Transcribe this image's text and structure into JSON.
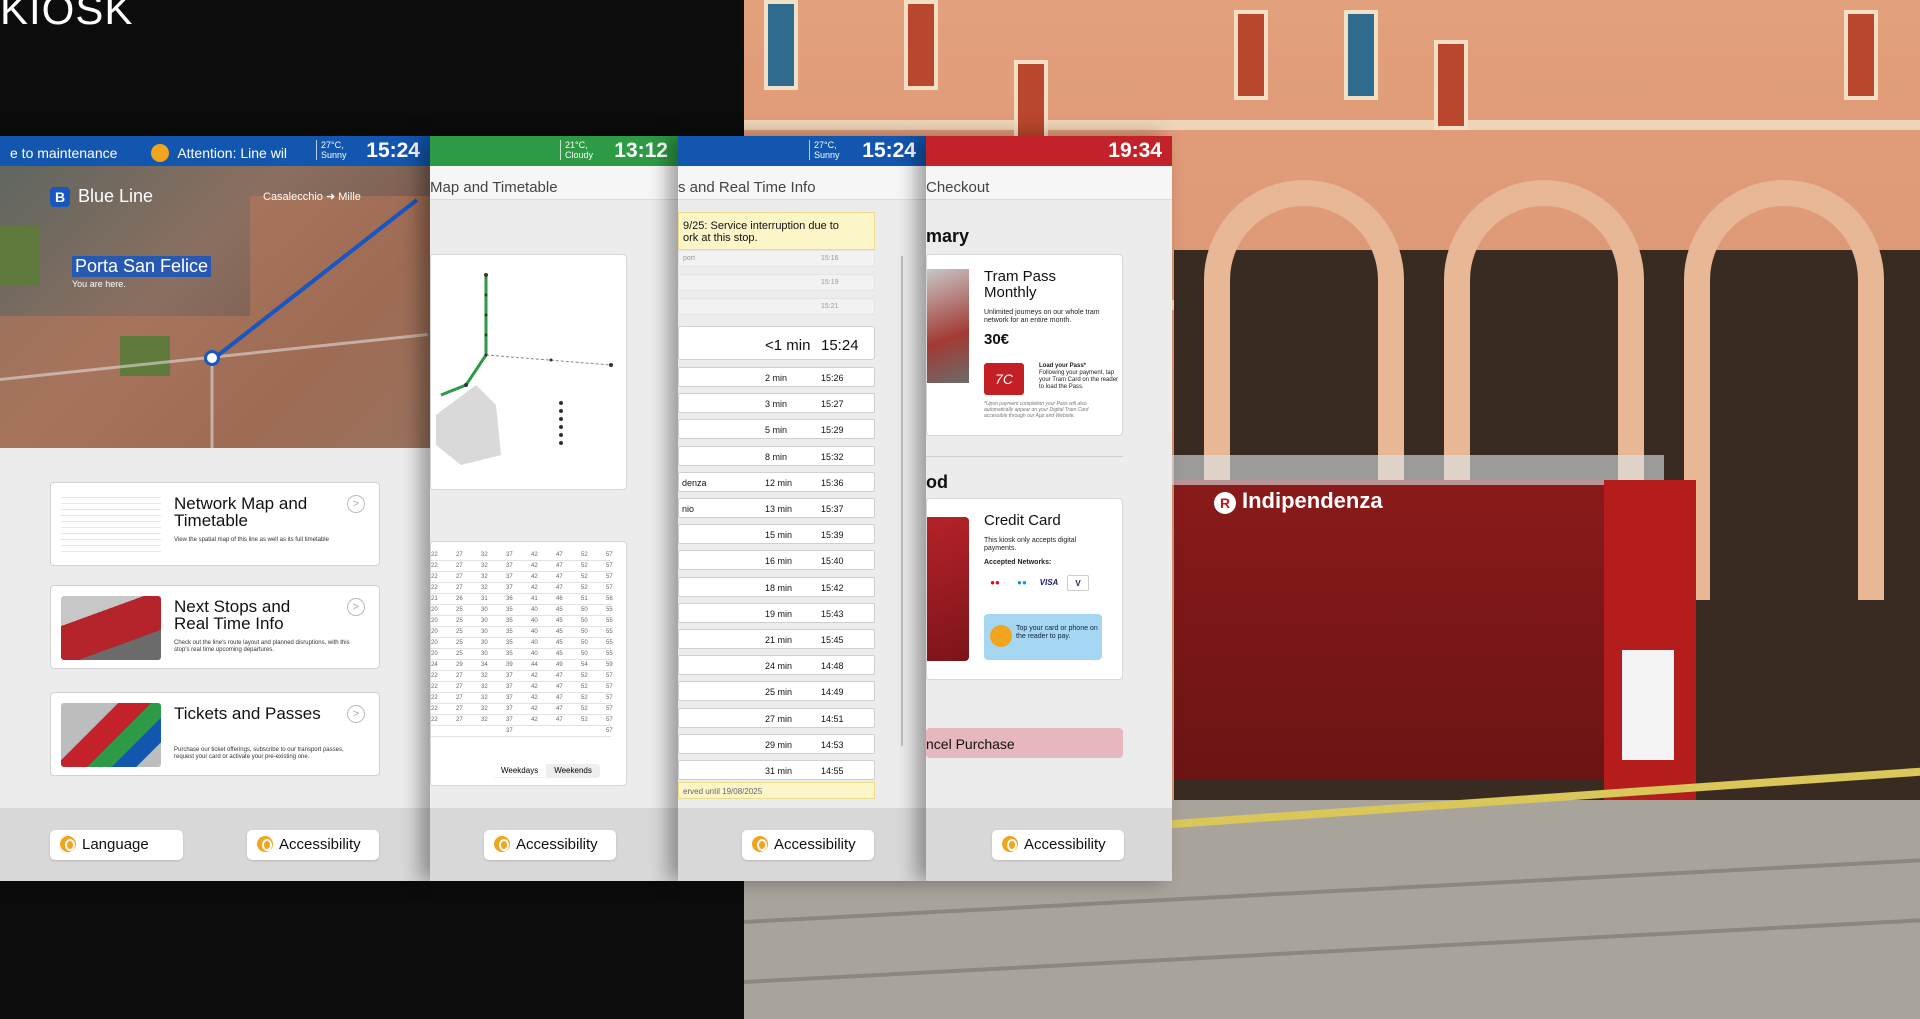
{
  "heading": "KIOSK",
  "screens": {
    "s1": {
      "marquee": "e to maintenance",
      "attention": "Attention: Line wil",
      "weather_temp": "27°C,",
      "weather_cond": "Sunny",
      "time": "15:24",
      "line_badge": "B",
      "line_name": "Blue Line",
      "route_from": "Casalecchio",
      "route_to": "Mille",
      "stop_name": "Porta San Felice",
      "here": "You are here.",
      "cards": [
        {
          "title": "Network Map and Timetable",
          "desc": "View the spatial map of this line as well as its full timetable"
        },
        {
          "title": "Next Stops and Real Time Info",
          "desc": "Check out the line's route layout and planned disruptions, with this stop's real time upcoming departures."
        },
        {
          "title": "Tickets and Passes",
          "desc": "Purchase our ticket offerings, subscribe to our transport passes, request your card or activate your pre-existing one."
        }
      ],
      "language": "Language",
      "accessibility": "Accessibility"
    },
    "s2": {
      "weather_temp": "21°C,",
      "weather_cond": "Cloudy",
      "time": "13:12",
      "title": "Map and Timetable",
      "tab_weekdays": "Weekdays",
      "tab_weekends": "Weekends",
      "accessibility": "Accessibility",
      "rows": [
        [
          "22",
          "27",
          "32",
          "37",
          "42",
          "47",
          "52",
          "57"
        ],
        [
          "22",
          "27",
          "32",
          "37",
          "42",
          "47",
          "52",
          "57"
        ],
        [
          "22",
          "27",
          "32",
          "37",
          "42",
          "47",
          "52",
          "57"
        ],
        [
          "22",
          "27",
          "32",
          "37",
          "42",
          "47",
          "52",
          "57"
        ],
        [
          "21",
          "26",
          "31",
          "36",
          "41",
          "46",
          "51",
          "56"
        ],
        [
          "20",
          "25",
          "30",
          "35",
          "40",
          "45",
          "50",
          "55"
        ],
        [
          "20",
          "25",
          "30",
          "35",
          "40",
          "45",
          "50",
          "55"
        ],
        [
          "20",
          "25",
          "30",
          "35",
          "40",
          "45",
          "50",
          "55"
        ],
        [
          "20",
          "25",
          "30",
          "35",
          "40",
          "45",
          "50",
          "55"
        ],
        [
          "20",
          "25",
          "30",
          "35",
          "40",
          "45",
          "50",
          "55"
        ],
        [
          "24",
          "29",
          "34",
          "39",
          "44",
          "49",
          "54",
          "59"
        ],
        [
          "22",
          "27",
          "32",
          "37",
          "42",
          "47",
          "52",
          "57"
        ],
        [
          "22",
          "27",
          "32",
          "37",
          "42",
          "47",
          "52",
          "57"
        ],
        [
          "22",
          "27",
          "32",
          "37",
          "42",
          "47",
          "52",
          "57"
        ],
        [
          "22",
          "27",
          "32",
          "37",
          "42",
          "47",
          "52",
          "57"
        ],
        [
          "22",
          "27",
          "32",
          "37",
          "42",
          "47",
          "52",
          "57"
        ],
        [
          "",
          "",
          "",
          "37",
          "",
          "",
          "",
          "57"
        ]
      ]
    },
    "s3": {
      "weather_temp": "27°C,",
      "weather_cond": "Sunny",
      "time": "15:24",
      "title": "s and Real Time Info",
      "alert_l1": "9/25: Service interruption due to",
      "alert_l2": "ork at this stop.",
      "past": [
        {
          "name": "port",
          "time": "15:16"
        },
        {
          "name": "",
          "time": "15:19"
        },
        {
          "name": "",
          "time": "15:21"
        }
      ],
      "next_wait": "<1 min",
      "next_time": "15:24",
      "departures": [
        {
          "name": "",
          "wait": "2 min",
          "time": "15:26"
        },
        {
          "name": "",
          "wait": "3 min",
          "time": "15:27"
        },
        {
          "name": "",
          "wait": "5 min",
          "time": "15:29"
        },
        {
          "name": "",
          "wait": "8 min",
          "time": "15:32"
        },
        {
          "name": "denza",
          "wait": "12 min",
          "time": "15:36"
        },
        {
          "name": "nio",
          "wait": "13 min",
          "time": "15:37"
        },
        {
          "name": "",
          "wait": "15 min",
          "time": "15:39"
        },
        {
          "name": "",
          "wait": "16 min",
          "time": "15:40"
        },
        {
          "name": "",
          "wait": "18 min",
          "time": "15:42"
        },
        {
          "name": "",
          "wait": "19 min",
          "time": "15:43"
        },
        {
          "name": "",
          "wait": "21 min",
          "time": "15:45"
        },
        {
          "name": "",
          "wait": "24 min",
          "time": "14:48"
        },
        {
          "name": "",
          "wait": "25 min",
          "time": "14:49"
        },
        {
          "name": "",
          "wait": "27 min",
          "time": "14:51"
        },
        {
          "name": "",
          "wait": "29 min",
          "time": "14:53"
        },
        {
          "name": "",
          "wait": "31 min",
          "time": "14:55"
        }
      ],
      "served": "erved until 19/08/2025",
      "accessibility": "Accessibility"
    },
    "s4": {
      "time": "19:34",
      "title": "Checkout",
      "summary": "mary",
      "product_title": "Tram Pass Monthly",
      "product_desc": "Unlimited journeys on our whole tram network for an entire month.",
      "price": "30€",
      "card_brand": "7C",
      "load_title": "Load your Pass*",
      "load_desc": "Following your payment, tap your Tram Card on the reader to load the Pass.",
      "fine": "*Upon payment completion your Pass will also automatically appear on your Digital Tram Card accessible through our App and Website.",
      "method": "od",
      "method_title": "Credit Card",
      "method_desc": "This kiosk only accepts digital payments.",
      "networks_label": "Accepted Networks:",
      "networks": [
        "mastercard",
        "maestro",
        "VISA",
        "V"
      ],
      "tap": "Top your card or phone on the reader to pay.",
      "cancel": "ncel Purchase",
      "accessibility": "Accessibility"
    }
  },
  "street_sign": "Indipendenza",
  "colors": {
    "blue": "#1256b0",
    "green": "#2d9a45",
    "red": "#c4222a",
    "accent": "#f2a41c"
  }
}
